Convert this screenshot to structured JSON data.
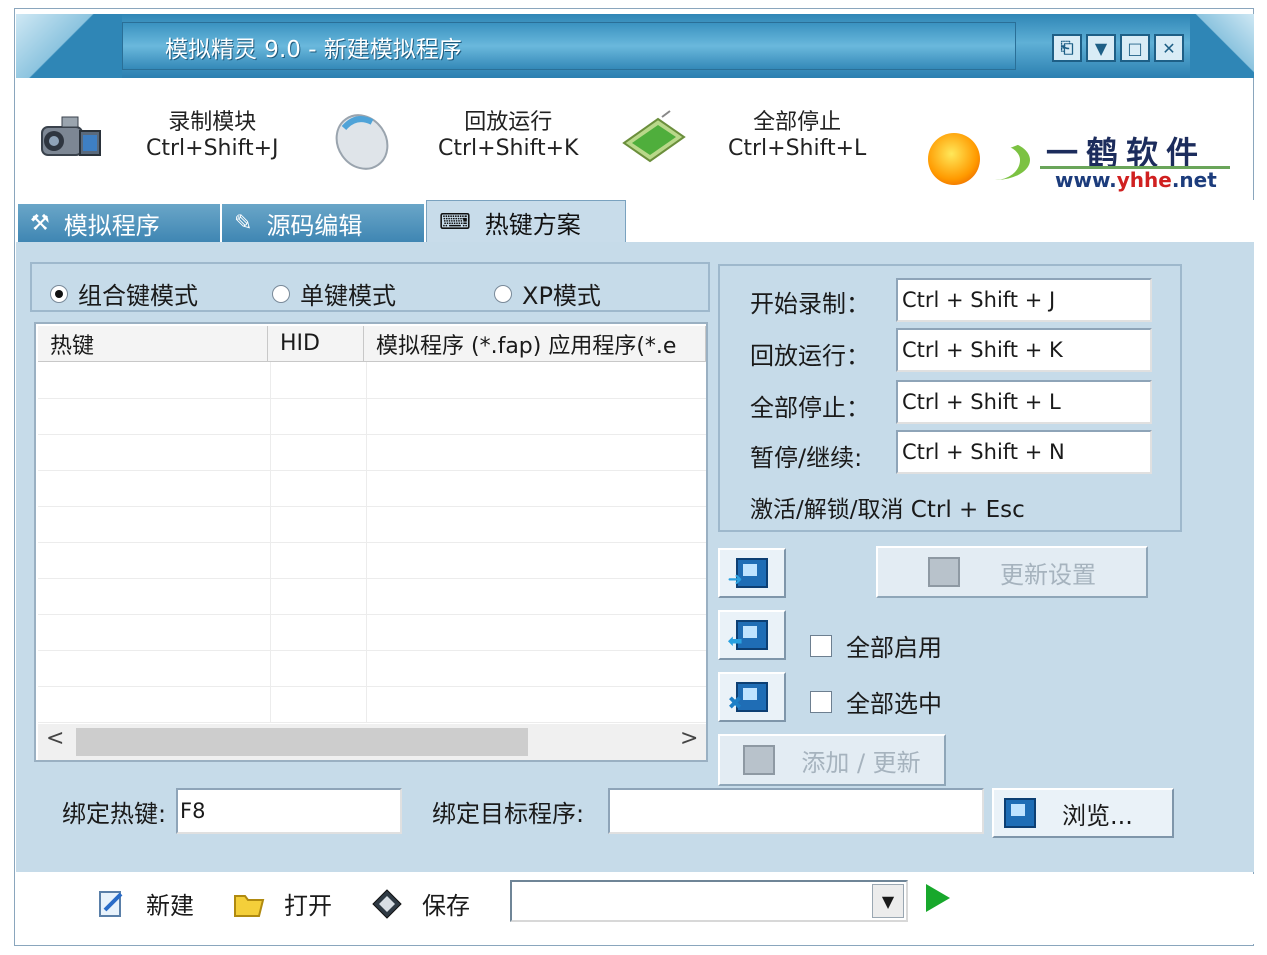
{
  "window": {
    "title": "模拟精灵 9.0 - 新建模拟程序",
    "controls": [
      "restore-icon",
      "minimize-icon",
      "maximize-icon",
      "close-icon"
    ]
  },
  "toolbar": {
    "record": {
      "label": "录制模块",
      "shortcut": "Ctrl+Shift+J",
      "icon": "camcorder-icon"
    },
    "playback": {
      "label": "回放运行",
      "shortcut": "Ctrl+Shift+K",
      "icon": "mouse-icon"
    },
    "stop": {
      "label": "全部停止",
      "shortcut": "Ctrl+Shift+L",
      "icon": "card-icon"
    }
  },
  "logo": {
    "cn": "一鹤软件",
    "url_prefix": "www.",
    "url_brand": "yhhe",
    "url_suffix": ".net"
  },
  "tabs": [
    {
      "label": "模拟程序",
      "icon": "tools-icon",
      "active": false
    },
    {
      "label": "源码编辑",
      "icon": "edit-icon",
      "active": false
    },
    {
      "label": "热键方案",
      "icon": "hotkey-icon",
      "active": true
    }
  ],
  "modes": [
    {
      "label": "组合键模式",
      "checked": true
    },
    {
      "label": "单键模式",
      "checked": false
    },
    {
      "label": "XP模式",
      "checked": false
    }
  ],
  "list": {
    "columns": [
      "热键",
      "HID",
      "模拟程序 (*.fap) 应用程序(*.e"
    ],
    "rows": []
  },
  "hotkeys": {
    "start_record": {
      "label": "开始录制：",
      "value": "Ctrl + Shift + J"
    },
    "playback": {
      "label": "回放运行：",
      "value": "Ctrl + Shift + K"
    },
    "stop_all": {
      "label": "全部停止：",
      "value": "Ctrl + Shift + L"
    },
    "pause": {
      "label": "暂停/继续:",
      "value": "Ctrl + Shift + N"
    },
    "note": "激活/解锁/取消 Ctrl + Esc"
  },
  "actions": {
    "update_settings": "更新设置",
    "enable_all": "全部启用",
    "select_all": "全部选中",
    "add_update": "添加 / 更新"
  },
  "bind": {
    "hotkey_label": "绑定热键:",
    "hotkey_value": "F8",
    "target_label": "绑定目标程序:",
    "target_value": "",
    "browse": "浏览..."
  },
  "bottom": {
    "new": "新建",
    "open": "打开",
    "save": "保存",
    "combo_value": ""
  },
  "colors": {
    "panel": "#c6dbe9",
    "title": "#2f86b6",
    "play": "#18a82c"
  }
}
